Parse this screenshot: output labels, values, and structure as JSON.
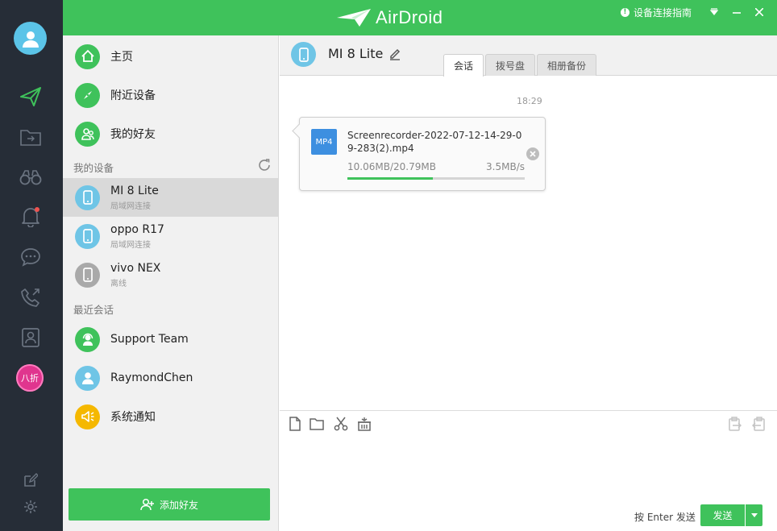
{
  "app": {
    "logo_text": "AirDroid"
  },
  "titlebar": {
    "guide_label": "设备连接指南"
  },
  "rail": {
    "promo_label": "八折",
    "icons": [
      "avatar-icon",
      "send-icon",
      "folder-icon",
      "binoculars-icon",
      "bell-icon",
      "chat-icon",
      "phone-icon",
      "contacts-icon",
      "edit-icon",
      "gear-icon"
    ]
  },
  "sidebar": {
    "nav": [
      {
        "label": "主页",
        "icon": "home-icon"
      },
      {
        "label": "附近设备",
        "icon": "compass-icon"
      },
      {
        "label": "我的好友",
        "icon": "friends-icon"
      }
    ],
    "devices_title": "我的设备",
    "devices": [
      {
        "name": "MI 8 Lite",
        "status": "局域网连接",
        "color": "#6fc5e6"
      },
      {
        "name": "oppo R17",
        "status": "局域网连接",
        "color": "#6fc5e6"
      },
      {
        "name": "vivo NEX",
        "status": "离线",
        "color": "#a9a9a9"
      }
    ],
    "recent_title": "最近会话",
    "recent": [
      {
        "name": "Support Team",
        "icon": "support-icon",
        "color": "#3fc25b"
      },
      {
        "name": "RaymondChen",
        "icon": "user-icon",
        "color": "#6fc5e6"
      },
      {
        "name": "系统通知",
        "icon": "speaker-icon",
        "color": "#f5b800"
      }
    ],
    "add_friend_label": "添加好友"
  },
  "main": {
    "device_name": "MI 8 Lite",
    "tabs": [
      {
        "label": "会话",
        "active": true
      },
      {
        "label": "拨号盘",
        "active": false
      },
      {
        "label": "相册备份",
        "active": false
      }
    ],
    "time": "18:29",
    "transfer": {
      "file_type": "MP4",
      "file_name": "Screenrecorder-2022-07-12-14-29-09-283(2).mp4",
      "size_text": "10.06MB/20.79MB",
      "speed_text": "3.5MB/s",
      "progress": 0.48
    },
    "composer": {
      "hint": "按 Enter 发送",
      "send_label": "发送"
    }
  },
  "colors": {
    "accent": "#3fc25b",
    "rail": "#262d37",
    "device_blue": "#6fc5e6"
  }
}
